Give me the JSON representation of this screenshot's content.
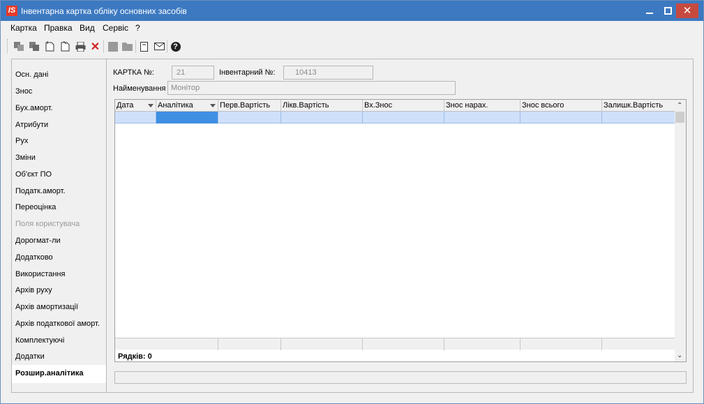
{
  "window": {
    "app_icon": "IS",
    "title": "Інвентарна картка обліку основних засобів",
    "minimize_icon": "minimize-icon",
    "maximize_icon": "maximize-icon",
    "close_label": "✕"
  },
  "menu": [
    "Картка",
    "Правка",
    "Вид",
    "Сервіс",
    "?"
  ],
  "toolbar": {
    "icons": [
      "copy-icon",
      "paste-icon",
      "new-document-icon",
      "edit-document-icon",
      "print-icon",
      "delete-icon",
      "save-icon",
      "folder-icon",
      "card-icon",
      "mail-icon",
      "help-icon"
    ],
    "delete_glyph": "✕",
    "help_glyph": "?"
  },
  "nav": {
    "items": [
      {
        "label": "Осн. дані"
      },
      {
        "label": "Знос"
      },
      {
        "label": "Бух.аморт."
      },
      {
        "label": "Атрибути"
      },
      {
        "label": "Рух"
      },
      {
        "label": "Зміни"
      },
      {
        "label": "Об'єкт ПО"
      },
      {
        "label": "Податк.аморт."
      },
      {
        "label": "Переоцінка"
      },
      {
        "label": "Поля користувача"
      },
      {
        "label": "Дорогмат-ли"
      },
      {
        "label": "Додатково"
      },
      {
        "label": "Використання"
      },
      {
        "label": "Архів руху"
      },
      {
        "label": "Архів амортизації"
      },
      {
        "label": "Архів податкової аморт."
      },
      {
        "label": "Комплектуючі"
      },
      {
        "label": "Додатки"
      },
      {
        "label": "Розшир.аналітика"
      }
    ],
    "active": "Розшир.аналітика",
    "disabled": "Поля користувача"
  },
  "form": {
    "card_no_label": "КАРТКА №:",
    "card_no_value": "21",
    "inventory_no_label": "Інвентарний №:",
    "inventory_no_value": "10413",
    "name_label": "Найменування",
    "name_value": "Монітор"
  },
  "grid": {
    "columns": [
      "Дата",
      "Аналітика",
      "Перв.Вартість",
      "Лікв.Вартість",
      "Вх.Знос",
      "Знос нарах.",
      "Знос всього",
      "Залишк.Вартість"
    ],
    "rows_label": "Рядків: 0",
    "scroll_up": "⌃",
    "scroll_down": "⌄"
  },
  "colors": {
    "titlebar": "#3c79c1",
    "selection": "#cfe0fa",
    "focus_cell": "#3f8fe3",
    "close_button": "#c74a3f"
  }
}
